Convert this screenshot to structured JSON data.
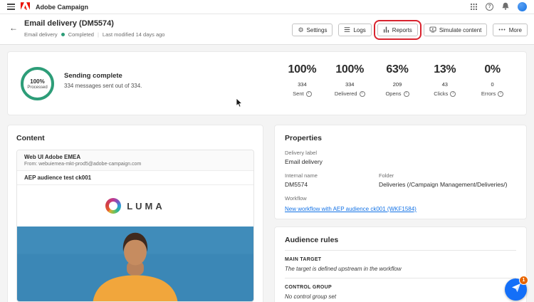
{
  "topbar": {
    "app_name": "Adobe Campaign"
  },
  "icons": {
    "back": "←",
    "help": "?",
    "settings": "⚙",
    "more_dots": "•••",
    "info": "i"
  },
  "header": {
    "title": "Email delivery (DM5574)",
    "type_label": "Email delivery",
    "status": "Completed",
    "last_modified": "Last modified 14 days ago",
    "buttons": [
      {
        "label": "Settings"
      },
      {
        "label": "Logs"
      },
      {
        "label": "Reports"
      },
      {
        "label": "Simulate content"
      },
      {
        "label": "More"
      }
    ]
  },
  "summary": {
    "ring_percent": "100%",
    "ring_label": "Processed",
    "title": "Sending complete",
    "subtitle": "334 messages sent out of 334.",
    "stats": [
      {
        "percent": "100%",
        "value": "334",
        "label": "Sent"
      },
      {
        "percent": "100%",
        "value": "334",
        "label": "Delivered"
      },
      {
        "percent": "63%",
        "value": "209",
        "label": "Opens"
      },
      {
        "percent": "13%",
        "value": "43",
        "label": "Clicks"
      },
      {
        "percent": "0%",
        "value": "0",
        "label": "Errors"
      }
    ]
  },
  "content": {
    "title": "Content",
    "sender_name": "Web UI Adobe EMEA",
    "from_line": "From: webuiemea-mkt-prod5@adobe-campaign.com",
    "subject": "AEP audience test ck001",
    "brand_name": "LUMA"
  },
  "properties": {
    "title": "Properties",
    "delivery_label": {
      "label": "Delivery label",
      "value": "Email delivery"
    },
    "internal_name": {
      "label": "Internal name",
      "value": "DM5574"
    },
    "folder": {
      "label": "Folder",
      "value": "Deliveries (/Campaign Management/Deliveries/)"
    },
    "workflow": {
      "label": "Workflow",
      "link": "New workflow with AEP audience ck001 (WKF1584)"
    }
  },
  "audience": {
    "title": "Audience rules",
    "main_target": {
      "label": "MAIN TARGET",
      "value": "The target is defined upstream in the workflow"
    },
    "control_group": {
      "label": "CONTROL GROUP",
      "value": "No control group set"
    }
  },
  "chat": {
    "badge": "1"
  },
  "colors": {
    "accent_blue": "#1473e6",
    "status_green": "#2d9d78",
    "adobe_red": "#eb1000",
    "annotation_red": "#d9232e",
    "badge_orange": "#e96500",
    "hero_blue": "#3b87b6"
  }
}
